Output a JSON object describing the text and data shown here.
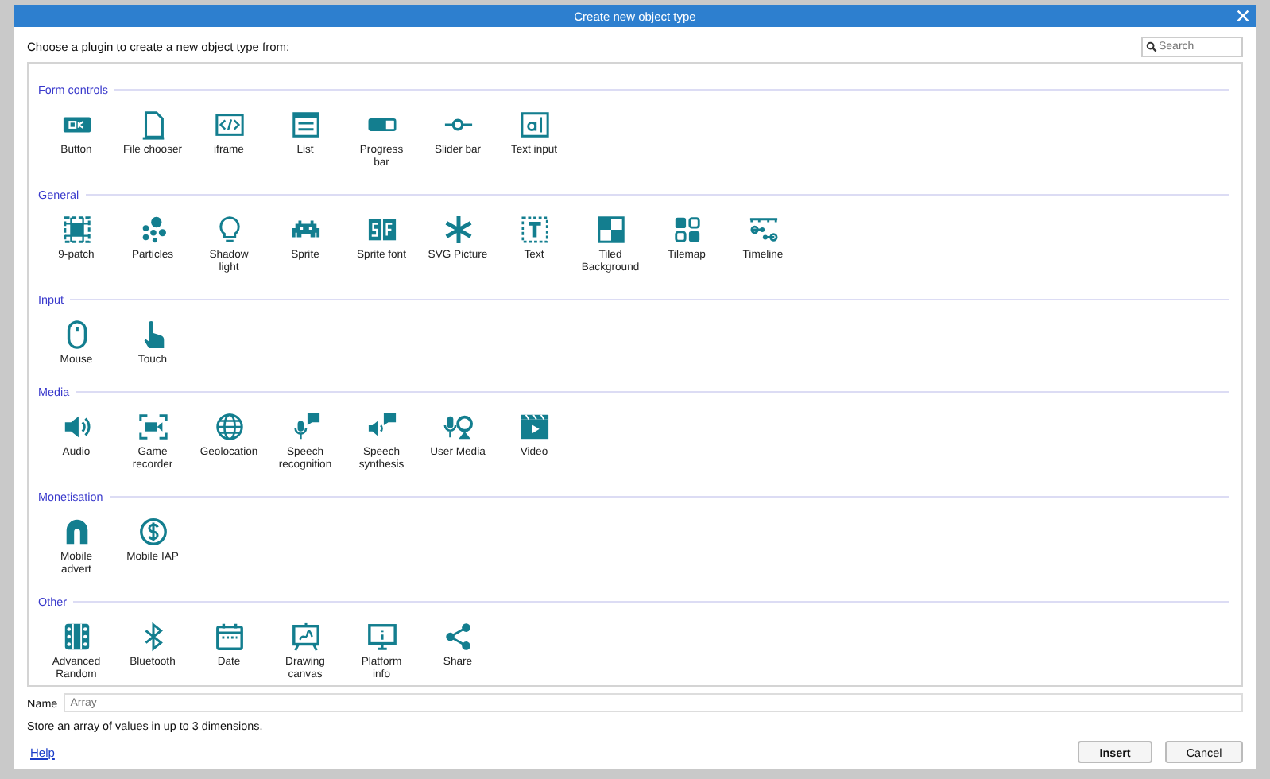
{
  "window": {
    "title": "Create new object type"
  },
  "prompt": "Choose a plugin to create a new object type from:",
  "search": {
    "placeholder": "Search"
  },
  "sections": [
    {
      "title": "Form controls",
      "items": [
        "Button",
        "File chooser",
        "iframe",
        "List",
        "Progress bar",
        "Slider bar",
        "Text input"
      ]
    },
    {
      "title": "General",
      "items": [
        "9-patch",
        "Particles",
        "Shadow light",
        "Sprite",
        "Sprite font",
        "SVG Picture",
        "Text",
        "Tiled Background",
        "Tilemap",
        "Timeline"
      ]
    },
    {
      "title": "Input",
      "items": [
        "Mouse",
        "Touch"
      ]
    },
    {
      "title": "Media",
      "items": [
        "Audio",
        "Game recorder",
        "Geolocation",
        "Speech recognition",
        "Speech synthesis",
        "User Media",
        "Video"
      ]
    },
    {
      "title": "Monetisation",
      "items": [
        "Mobile advert",
        "Mobile IAP"
      ]
    },
    {
      "title": "Other",
      "items": [
        "Advanced Random",
        "Bluetooth",
        "Date",
        "Drawing canvas",
        "Platform info",
        "Share"
      ]
    }
  ],
  "name_field": {
    "label": "Name",
    "placeholder": "Array"
  },
  "description": "Store an array of values in up to 3 dimensions.",
  "help_link": "Help",
  "buttons": [
    {
      "label": "Insert",
      "default": true
    },
    {
      "label": "Cancel",
      "default": false
    }
  ]
}
